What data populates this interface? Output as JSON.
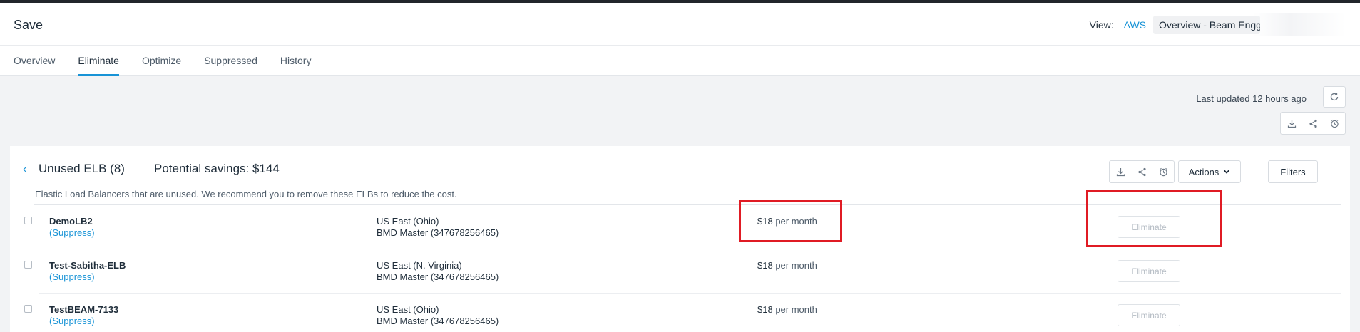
{
  "header": {
    "title": "Save",
    "view_label": "View:",
    "view_provider": "AWS",
    "view_selected": "Overview - Beam Engg"
  },
  "tabs": [
    {
      "label": "Overview",
      "active": false
    },
    {
      "label": "Eliminate",
      "active": true
    },
    {
      "label": "Optimize",
      "active": false
    },
    {
      "label": "Suppressed",
      "active": false
    },
    {
      "label": "History",
      "active": false
    }
  ],
  "toolbar": {
    "last_updated": "Last updated 12 hours ago",
    "icons": [
      "refresh-icon",
      "download-icon",
      "share-icon",
      "schedule-icon"
    ]
  },
  "card": {
    "title": "Unused ELB (8)",
    "savings": "Potential savings: $144",
    "description": "Elastic Load Balancers that are unused. We recommend you to remove these ELBs to reduce the cost.",
    "actions_label": "Actions",
    "filters_label": "Filters"
  },
  "rows": [
    {
      "name": "DemoLB2",
      "suppress": "(Suppress)",
      "region": "US East (Ohio)",
      "account": "BMD Master (347678256465)",
      "cost": "$18",
      "unit": "per month",
      "action": "Eliminate"
    },
    {
      "name": "Test-Sabitha-ELB",
      "suppress": "(Suppress)",
      "region": "US East (N. Virginia)",
      "account": "BMD Master (347678256465)",
      "cost": "$18",
      "unit": "per month",
      "action": "Eliminate"
    },
    {
      "name": "TestBEAM-7133",
      "suppress": "(Suppress)",
      "region": "US East (Ohio)",
      "account": "BMD Master (347678256465)",
      "cost": "$18",
      "unit": "per month",
      "action": "Eliminate"
    }
  ],
  "colors": {
    "accent": "#1893d6",
    "highlight": "#e01b24",
    "topbar": "#22262b"
  }
}
